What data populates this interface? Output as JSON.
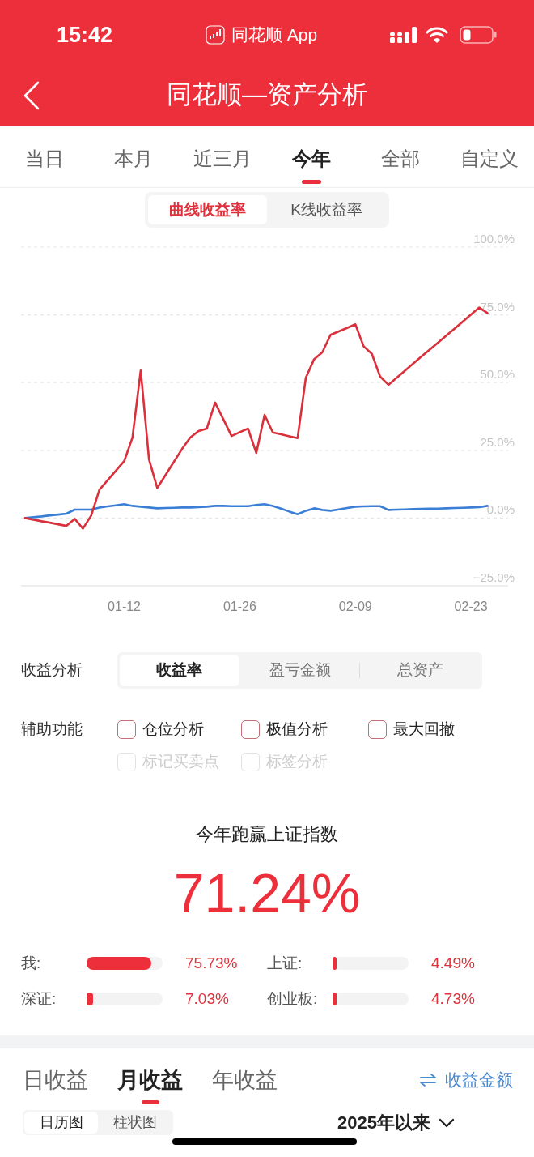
{
  "status_bar": {
    "time": "15:42",
    "app_label": "同花顺 App"
  },
  "header": {
    "title": "同花顺—资产分析"
  },
  "period_tabs": [
    {
      "label": "当日",
      "selected": false
    },
    {
      "label": "本月",
      "selected": false
    },
    {
      "label": "近三月",
      "selected": false
    },
    {
      "label": "今年",
      "selected": true
    },
    {
      "label": "全部",
      "selected": false
    },
    {
      "label": "自定义",
      "selected": false
    }
  ],
  "chart_mode_tabs": [
    {
      "label": "曲线收益率",
      "selected": true
    },
    {
      "label": "K线收益率",
      "selected": false
    }
  ],
  "chart": {
    "chart_data": {
      "type": "line",
      "grid": true,
      "categories": [
        null,
        null,
        null,
        null,
        null,
        null,
        null,
        null,
        null,
        null,
        null,
        null,
        "01-12",
        null,
        null,
        null,
        null,
        null,
        null,
        null,
        null,
        null,
        null,
        null,
        null,
        null,
        "01-26",
        null,
        null,
        null,
        null,
        null,
        null,
        null,
        null,
        null,
        null,
        null,
        null,
        null,
        "02-09",
        null,
        null,
        null,
        null,
        null,
        null,
        null,
        null,
        null,
        null,
        null,
        null,
        null,
        "02-23",
        null,
        null
      ],
      "series": [
        {
          "color": "#d9303c",
          "values": [
            0,
            -0.6,
            -1.2,
            -1.7,
            -2.3,
            -2.9,
            -0.3,
            -3.9,
            0.9,
            10.5,
            14.0,
            17.5,
            21.0,
            29.7,
            54.5,
            21.6,
            11.1,
            15.9,
            20.7,
            25.5,
            29.7,
            32.1,
            33.0,
            42.6,
            36.5,
            30.3,
            31.7,
            33.0,
            24.0,
            38.1,
            31.6,
            30.9,
            30.2,
            29.5,
            51.8,
            58.6,
            61.2,
            67.6,
            68.9,
            70.2,
            71.5,
            63.4,
            60.6,
            52.2,
            49.2,
            51.8,
            54.4,
            57.0,
            59.6,
            62.2,
            64.7,
            67.3,
            69.9,
            72.5,
            75.1,
            77.7,
            75.7
          ]
        },
        {
          "color": "#3a7fd5",
          "values": [
            0,
            0.3,
            0.6,
            1.0,
            1.3,
            1.6,
            3.1,
            3.1,
            3.1,
            3.9,
            4.3,
            4.7,
            5.1,
            4.5,
            4.2,
            3.9,
            3.6,
            3.7,
            3.8,
            3.9,
            3.9,
            4.0,
            4.2,
            4.5,
            4.5,
            4.4,
            4.4,
            4.4,
            4.8,
            5.1,
            4.5,
            3.5,
            2.4,
            1.4,
            2.7,
            3.6,
            3.0,
            2.7,
            3.2,
            3.7,
            4.2,
            4.3,
            4.4,
            4.4,
            3.0,
            3.1,
            3.2,
            3.3,
            3.4,
            3.5,
            3.5,
            3.6,
            3.7,
            3.8,
            3.9,
            4.0,
            4.5
          ]
        }
      ],
      "ylim": [
        -25,
        100
      ],
      "yticks": [
        {
          "value": 100,
          "label": "100.0%"
        },
        {
          "value": 75,
          "label": "75.0%"
        },
        {
          "value": 50,
          "label": "50.0%"
        },
        {
          "value": 25,
          "label": "25.0%"
        },
        {
          "value": 0,
          "label": "0.0%"
        },
        {
          "value": -25,
          "label": "−25.0%"
        }
      ]
    }
  },
  "return_analysis": {
    "label": "收益分析",
    "options": [
      {
        "label": "收益率",
        "selected": true
      },
      {
        "label": "盈亏金额",
        "selected": false
      },
      {
        "label": "总资产",
        "selected": false
      }
    ]
  },
  "aux_functions": {
    "label": "辅助功能",
    "options": [
      {
        "label": "仓位分析",
        "checked": false,
        "disabled": false
      },
      {
        "label": "极值分析",
        "checked": false,
        "disabled": false
      },
      {
        "label": "最大回撤",
        "checked": false,
        "disabled": false
      },
      {
        "label": "标记买卖点",
        "checked": false,
        "disabled": true
      },
      {
        "label": "标签分析",
        "checked": false,
        "disabled": true
      }
    ]
  },
  "comparison": {
    "title": "今年跑赢上证指数",
    "excess": "71.24%",
    "rows": [
      {
        "label": "我:",
        "level": 0.85,
        "value": "75.73%"
      },
      {
        "label": "上证:",
        "level": 0.05,
        "value": "4.49%"
      },
      {
        "label": "深证:",
        "level": 0.08,
        "value": "7.03%"
      },
      {
        "label": "创业板:",
        "level": 0.05,
        "value": "4.73%"
      }
    ]
  },
  "returns_tabs": [
    {
      "label": "日收益",
      "selected": false
    },
    {
      "label": "月收益",
      "selected": true
    },
    {
      "label": "年收益",
      "selected": false
    }
  ],
  "switch_link": {
    "label": "收益金额"
  },
  "view_tabs": [
    {
      "label": "日历图",
      "selected": true
    },
    {
      "label": "柱状图",
      "selected": false
    }
  ],
  "range_selector": {
    "label": "2025年以来"
  }
}
